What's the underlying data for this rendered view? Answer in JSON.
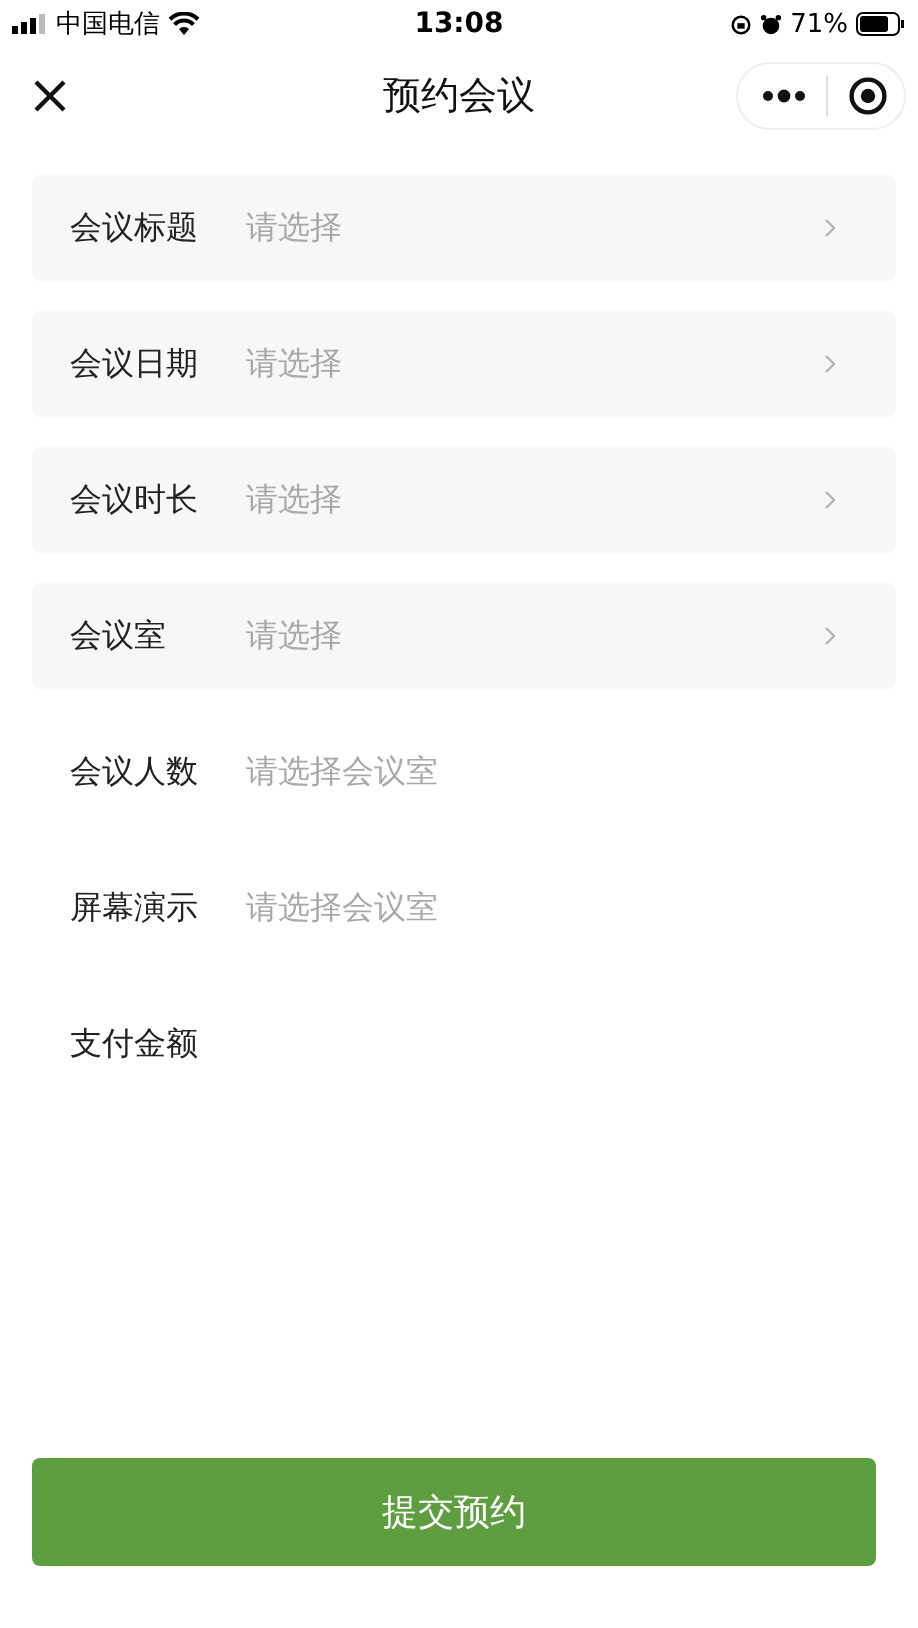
{
  "status_bar": {
    "carrier": "中国电信",
    "time": "13:08",
    "battery": "71%"
  },
  "header": {
    "title": "预约会议"
  },
  "fields": [
    {
      "kind": "picker",
      "label": "会议标题",
      "placeholder": "请选择"
    },
    {
      "kind": "picker",
      "label": "会议日期",
      "placeholder": "请选择"
    },
    {
      "kind": "picker",
      "label": "会议时长",
      "placeholder": "请选择"
    },
    {
      "kind": "picker",
      "label": "会议室",
      "placeholder": "请选择"
    },
    {
      "kind": "info",
      "label": "会议人数",
      "placeholder": "请选择会议室"
    },
    {
      "kind": "info",
      "label": "屏幕演示",
      "placeholder": "请选择会议室"
    },
    {
      "kind": "info",
      "label": "支付金额"
    }
  ],
  "submit": {
    "label": "提交预约"
  }
}
